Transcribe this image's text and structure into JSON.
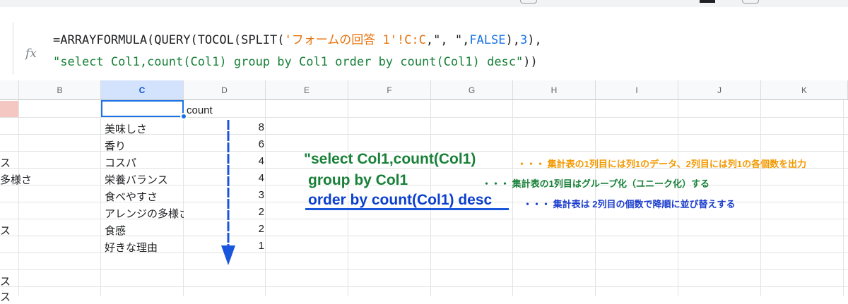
{
  "formula_bar": {
    "fx_icon": "fx-icon",
    "line1_prefix": "=ARRAYFORMULA(QUERY(TOCOL(SPLIT(",
    "line1_string": "'フォームの回答 1'!C:C",
    "line1_mid": ",\", \",",
    "line1_false": "FALSE",
    "line1_close": "),",
    "line1_three": "3",
    "line1_end": "),",
    "line2_string": "\"select Col1,count(Col1) group by Col1 order by count(Col1) desc\"",
    "line2_end": "))"
  },
  "columns": [
    "",
    "B",
    "C",
    "D",
    "E",
    "F",
    "G",
    "H",
    "I",
    "J",
    "K"
  ],
  "selected_column": "C",
  "col_a_fragments": [
    "ス",
    "多様さ",
    "ス",
    "ス",
    "ス"
  ],
  "header_cell_d": "count",
  "rows": [
    {
      "item": "美味しさ",
      "count": "8"
    },
    {
      "item": "香り",
      "count": "6"
    },
    {
      "item": "コスパ",
      "count": "4"
    },
    {
      "item": "栄養バランス",
      "count": "4"
    },
    {
      "item": "食べやすさ",
      "count": "3"
    },
    {
      "item": "アレンジの多様さ",
      "count": "2"
    },
    {
      "item": "食感",
      "count": "2"
    },
    {
      "item": "好きな理由",
      "count": "1"
    }
  ],
  "annotations": {
    "select_line": "\"select Col1,count(Col1)",
    "select_note": "・・・ 集計表の1列目には列1のデータ、2列目には列1の各個数を出力",
    "group_line": "group by Col1",
    "group_note": "・・・ 集計表の1列目はグループ化（ユニーク化）する",
    "order_line": "order by count(Col1) desc",
    "order_note": "・・・ 集計表は 2列目の個数で降順に並び替えする"
  },
  "colors": {
    "green": "#188038",
    "orange": "#f29900",
    "blue": "#1a3ccd",
    "arrow": "#1a56db",
    "selection": "#1a73e8"
  }
}
